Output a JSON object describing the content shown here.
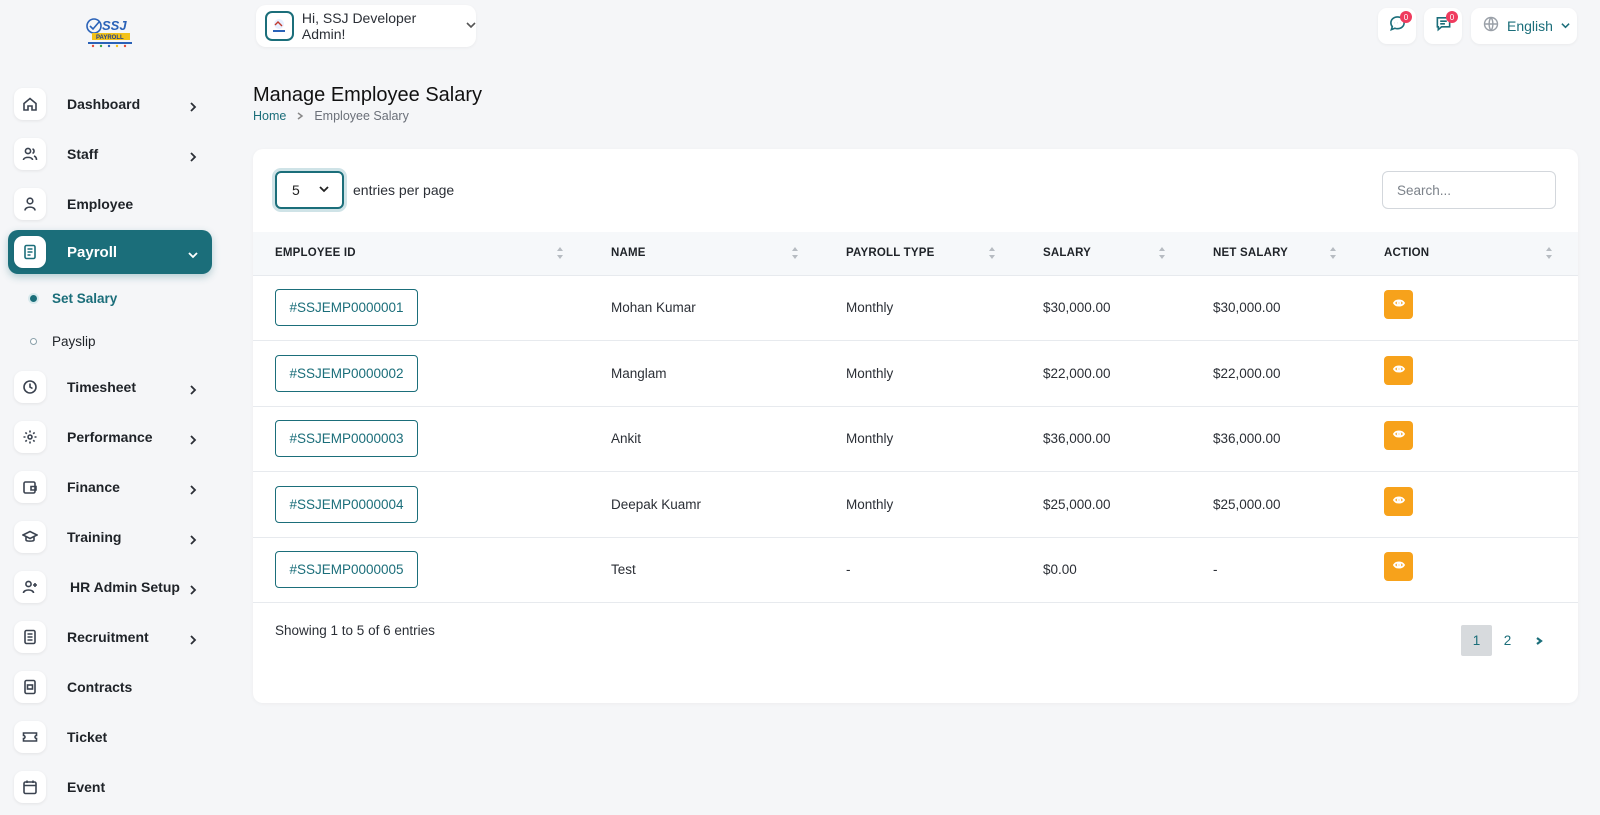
{
  "header": {
    "greeting": "Hi, SSJ Developer Admin!",
    "messages_badge": "0",
    "notifications_badge": "0",
    "language": "English"
  },
  "sidebar": {
    "items": [
      {
        "label": "Dashboard",
        "icon": "home-icon",
        "has_chevron": true
      },
      {
        "label": "Staff",
        "icon": "users-icon",
        "has_chevron": true
      },
      {
        "label": "Employee",
        "icon": "user-icon",
        "has_chevron": false
      },
      {
        "label": "Payroll",
        "icon": "receipt-icon",
        "has_chevron": true,
        "active": true
      },
      {
        "label": "Timesheet",
        "icon": "clock-icon",
        "has_chevron": true
      },
      {
        "label": "Performance",
        "icon": "performance-icon",
        "has_chevron": true
      },
      {
        "label": "Finance",
        "icon": "wallet-icon",
        "has_chevron": true
      },
      {
        "label": "Training",
        "icon": "graduation-cap-icon",
        "has_chevron": true
      },
      {
        "label": "HR Admin Setup",
        "icon": "user-plus-icon",
        "has_chevron": true
      },
      {
        "label": "Recruitment",
        "icon": "document-icon",
        "has_chevron": true
      },
      {
        "label": "Contracts",
        "icon": "contract-icon",
        "has_chevron": false
      },
      {
        "label": "Ticket",
        "icon": "ticket-icon",
        "has_chevron": false
      },
      {
        "label": "Event",
        "icon": "calendar-icon",
        "has_chevron": false
      }
    ],
    "payroll_sub": [
      {
        "label": "Set Salary",
        "active": true
      },
      {
        "label": "Payslip",
        "active": false
      }
    ]
  },
  "page": {
    "title": "Manage Employee Salary",
    "breadcrumb_home": "Home",
    "breadcrumb_current": "Employee Salary"
  },
  "table_controls": {
    "entries_value": "5",
    "entries_label": "entries per page",
    "search_placeholder": "Search..."
  },
  "table": {
    "columns": [
      "Employee ID",
      "Name",
      "Payroll Type",
      "Salary",
      "Net Salary",
      "Action"
    ],
    "rows": [
      {
        "id": "#SSJEMP0000001",
        "name": "Mohan Kumar",
        "payroll_type": "Monthly",
        "salary": "$30,000.00",
        "net_salary": "$30,000.00"
      },
      {
        "id": "#SSJEMP0000002",
        "name": "Manglam",
        "payroll_type": "Monthly",
        "salary": "$22,000.00",
        "net_salary": "$22,000.00"
      },
      {
        "id": "#SSJEMP0000003",
        "name": "Ankit",
        "payroll_type": "Monthly",
        "salary": "$36,000.00",
        "net_salary": "$36,000.00"
      },
      {
        "id": "#SSJEMP0000004",
        "name": "Deepak Kuamr",
        "payroll_type": "Monthly",
        "salary": "$25,000.00",
        "net_salary": "$25,000.00"
      },
      {
        "id": "#SSJEMP0000005",
        "name": "Test",
        "payroll_type": "-",
        "salary": "$0.00",
        "net_salary": "-"
      }
    ]
  },
  "footer": {
    "showing": "Showing 1 to 5 of 6 entries",
    "pages": [
      "1",
      "2"
    ],
    "current_page": "1"
  },
  "colors": {
    "primary": "#1b6e7a",
    "action": "#f7a21b",
    "badge": "#ef3b5e"
  }
}
